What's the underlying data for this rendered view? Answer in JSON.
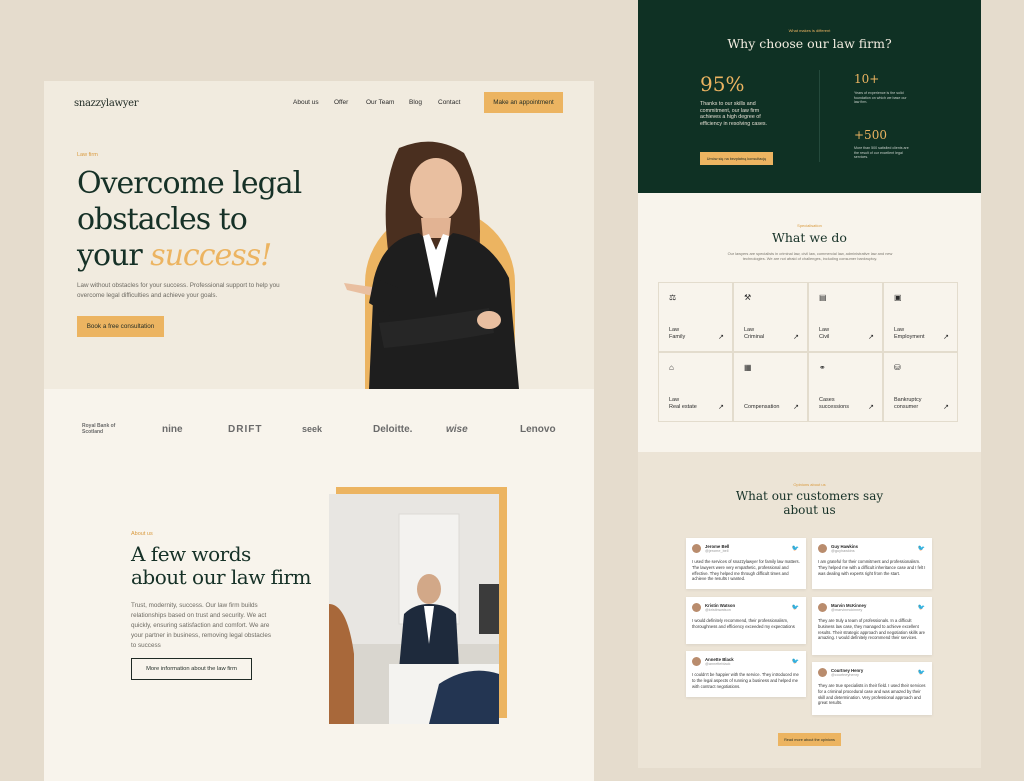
{
  "left": {
    "logo": "snazzylawyer",
    "nav": [
      "About us",
      "Offer",
      "Our Team",
      "Blog",
      "Contact"
    ],
    "cta": "Make an appointment",
    "hero": {
      "eyebrow": "Law firm",
      "title_line1": "Overcome legal",
      "title_line2": "obstacles to",
      "title_line3": "your",
      "title_accent": "success!",
      "description": "Law without obstacles for your success. Professional support to help you overcome legal difficulties and achieve your goals.",
      "button": "Book a free consultation"
    },
    "logos": [
      "Royal Bank of Scotland",
      "nine",
      "DRIFT",
      "seek",
      "Deloitte.",
      "wise",
      "Lenovo"
    ],
    "about": {
      "eyebrow": "About us",
      "title_line1": "A few words",
      "title_line2": "about our law firm",
      "description": "Trust, modernity, success. Our law firm builds relationships based on trust and security. We act quickly, ensuring satisfaction and comfort. We are your partner in business, removing legal obstacles to success",
      "button": "More information about the law firm"
    }
  },
  "right": {
    "why": {
      "eyebrow": "What makes is different",
      "title": "Why choose our law firm?",
      "stat_main": "95%",
      "stat_main_text": "Thanks to our skills and commitment, our law firm achieves a high degree of efficiency in resolving cases.",
      "stat_years": "10+",
      "stat_years_text": "Years of experience is the solid foundation on which we base our law firm.",
      "stat_clients": "+500",
      "stat_clients_text": "More than 500 satisfied clients are the result of our excellent legal services.",
      "button": "Umów się na bezpłatną konsultację"
    },
    "what": {
      "eyebrow": "Specialisation",
      "title": "What we do",
      "description": "Our lawyers are specialists in criminal law, civil law, commercial law, administrative law and new technologies. We are not afraid of challenges, including consumer bankruptcy.",
      "services": [
        {
          "line1": "Law",
          "line2": "Family",
          "icon": "scales-icon"
        },
        {
          "line1": "Law",
          "line2": "Criminal",
          "icon": "gavel-icon"
        },
        {
          "line1": "Law",
          "line2": "Civil",
          "icon": "document-icon"
        },
        {
          "line1": "Law",
          "line2": "Employment",
          "icon": "briefcase-icon"
        },
        {
          "line1": "Law",
          "line2": "Real estate",
          "icon": "house-icon"
        },
        {
          "line1": "",
          "line2": "Compensation",
          "icon": "receipt-icon"
        },
        {
          "line1": "Cases",
          "line2": "successions",
          "icon": "handshake-icon"
        },
        {
          "line1": "Bankruptcy",
          "line2": "consumer",
          "icon": "coins-icon"
        }
      ]
    },
    "testimonials": {
      "eyebrow": "Opinions about us",
      "title_line1": "What our customers say",
      "title_line2": "about us",
      "cards": [
        {
          "name": "Jerome Bell",
          "handle": "@jerome_bell",
          "text": "I used the services of snazzylawyer for family law matters. The lawyers were very empathetic, professional and effective. They helped me through difficult times and achieve the results I wanted."
        },
        {
          "name": "Guy Hawkins",
          "handle": "@guyhawkins",
          "text": "I am grateful for their commitment and professionalism. They helped me with a difficult inheritance case and I felt I was dealing with experts right from the start."
        },
        {
          "name": "Kristin Watson",
          "handle": "@kristinwatson",
          "text": "I would definitely recommend, their professionalism, thoroughness and efficiency exceeded my expectations"
        },
        {
          "name": "Marvin McKinney",
          "handle": "@marvinmckinney",
          "text": "They are truly a team of professionals. In a difficult business law case, they managed to achieve excellent results. Their strategic approach and negotiation skills are amazing. I would definitely recommend their services."
        },
        {
          "name": "Annette Black",
          "handle": "@annetteblack",
          "text": "I couldn't be happier with the service. They introduced me to the legal aspects of running a business and helped me with contract negotiations."
        },
        {
          "name": "Courtney Henry",
          "handle": "@courtneyhenry",
          "text": "They are true specialists in their field. I used their services for a criminal procedural case and was amazed by their skill and determination. Very professional approach and great results."
        }
      ],
      "button": "Read more about the opinions"
    }
  }
}
